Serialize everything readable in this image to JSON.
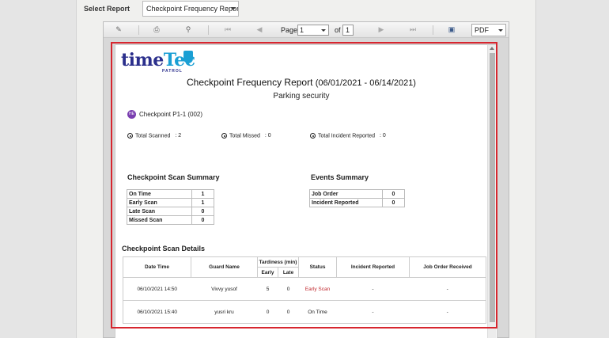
{
  "header": {
    "select_label": "Select Report",
    "selected_report": "Checkpoint Frequency Report"
  },
  "toolbar": {
    "page_label": "Page",
    "page_value": "1",
    "of_label": "of",
    "total_pages": "1",
    "format_value": "PDF"
  },
  "report": {
    "logo_time": "time",
    "logo_tec": "Tec",
    "logo_sub": "PATROL",
    "title": "Checkpoint Frequency Report",
    "date_range": "(06/01/2021 - 06/14/2021)",
    "subtitle": "Parking security",
    "checkpoint_badge": "HE",
    "checkpoint_name": "Checkpoint P1-1 (002)",
    "stats": [
      {
        "label": "Total Scanned",
        "value": ": 2"
      },
      {
        "label": "Total Missed",
        "value": ": 0"
      },
      {
        "label": "Total Incident Reported",
        "value": ": 0"
      }
    ],
    "scan_summary": {
      "title": "Checkpoint Scan Summary",
      "rows": [
        {
          "label": "On Time",
          "value": "1"
        },
        {
          "label": "Early Scan",
          "value": "1"
        },
        {
          "label": "Late Scan",
          "value": "0"
        },
        {
          "label": "Missed Scan",
          "value": "0"
        }
      ]
    },
    "events_summary": {
      "title": "Events Summary",
      "rows": [
        {
          "label": "Job Order",
          "value": "0"
        },
        {
          "label": "Incident Reported",
          "value": "0"
        }
      ]
    },
    "details": {
      "title": "Checkpoint Scan Details",
      "headers": {
        "date_time": "Date Time",
        "guard_name": "Guard Name",
        "tardiness": "Tardiness (min)",
        "early": "Early",
        "late": "Late",
        "status": "Status",
        "incident": "Incident Reported",
        "job_order": "Job Order Received"
      },
      "rows": [
        {
          "date_time": "06/10/2021 14:50",
          "guard": "Vivvy yusof",
          "early": "5",
          "late": "0",
          "status": "Early Scan",
          "incident": "-",
          "job_order": "-"
        },
        {
          "date_time": "06/10/2021 15:40",
          "guard": "yusri kru",
          "early": "0",
          "late": "0",
          "status": "On Time",
          "incident": "-",
          "job_order": "-"
        }
      ]
    }
  },
  "colors": {
    "highlight": "#d7262f",
    "early_scan": "#c0272d",
    "logo_blue": "#2b2f8c",
    "logo_cyan": "#1a9fd4"
  }
}
